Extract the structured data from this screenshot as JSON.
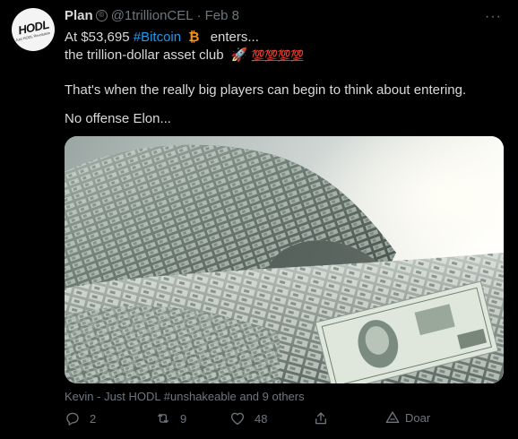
{
  "tweet": {
    "author_name": "Plan",
    "verified_glyph": "©",
    "handle": "@1trillionCEL",
    "separator": "·",
    "date": "Feb 8",
    "more_label": "···",
    "line1_prefix": "At $53,695",
    "hashtag": "#Bitcoin",
    "btc_glyph": "₿",
    "line1_suffix": "enters...",
    "line2": "the trillion-dollar asset club",
    "rocket_glyph": "🚀",
    "hundreds": "💯💯💯💯",
    "paragraph2": "That's when the really big players can begin to think about entering.",
    "paragraph3": "No offense Elon...",
    "media_caption": "Kevin - Just HODL #unshakeable and 9 others"
  },
  "avatar": {
    "logo_text": "HODL",
    "logo_sub": "Just HODL Revolution"
  },
  "actions": {
    "reply_count": "2",
    "retweet_count": "9",
    "like_count": "48",
    "donate_label": "Doar"
  },
  "colors": {
    "background": "#000000",
    "accent": "#1d9bf0",
    "muted": "#6e767d",
    "bitcoin": "#f7931a"
  },
  "icons": [
    "reply-icon",
    "retweet-icon",
    "like-icon",
    "share-icon",
    "donate-icon",
    "more-icon"
  ]
}
